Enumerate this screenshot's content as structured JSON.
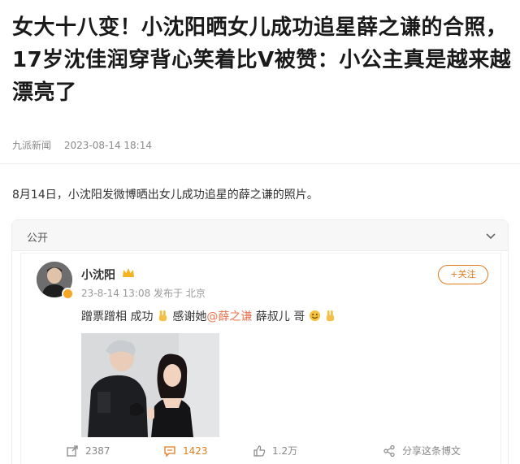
{
  "article": {
    "headline": "女大十八变！小沈阳晒女儿成功追星薛之谦的合照，17岁沈佳润穿背心笑着比V被赞：小公主真是越来越漂亮了",
    "source": "九派新闻",
    "date": "2023-08-14 18:14",
    "body": "8月14日，小沈阳发微博晒出女儿成功追星的薛之谦的照片。"
  },
  "card": {
    "visibility": "公开",
    "icons": {
      "collapse": "chevron-down-icon",
      "verified": "v-badge-icon",
      "vip": "crown-icon"
    },
    "post": {
      "username": "小沈阳",
      "meta": "23-8-14 13:08 发布于 北京",
      "follow_label": "+关注",
      "text_part1": "蹭票蹭相 成功",
      "text_part2": " 感谢她",
      "mention": "@薛之谦",
      "text_part3": " 薛叔儿 哥",
      "stats": {
        "share": "2387",
        "comments": "1423",
        "likes": "1.2万",
        "share_post": "分享这条博文"
      }
    },
    "accent_color": "#e07c1c",
    "mention_color": "#eb7350"
  }
}
